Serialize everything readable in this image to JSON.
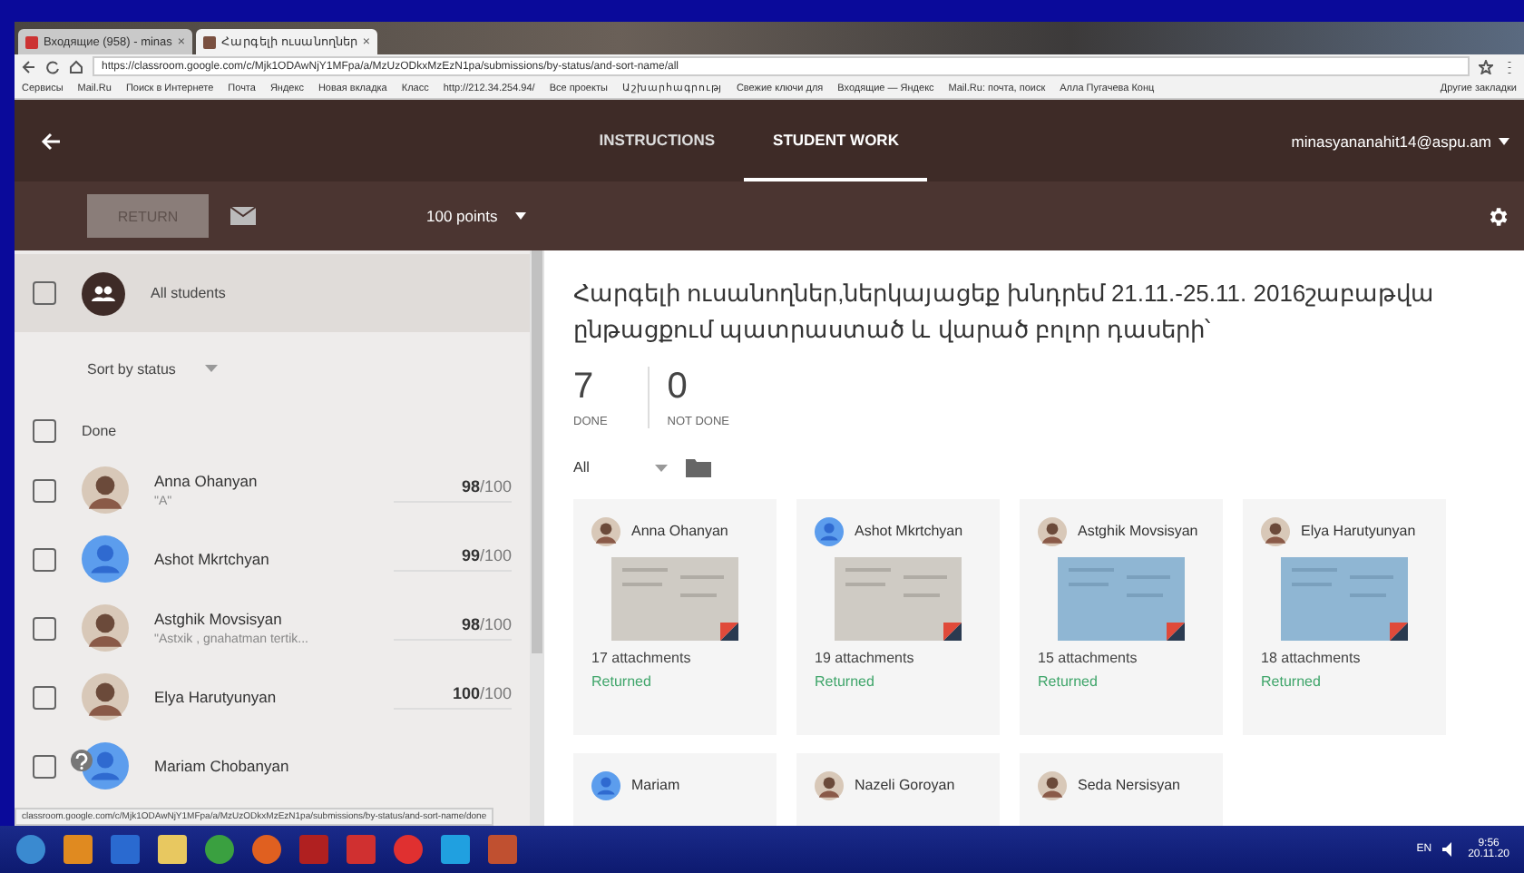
{
  "browser": {
    "tabs": [
      {
        "title": "Входящие (958) - minas",
        "close": "×",
        "selected": false
      },
      {
        "title": "Հարգելի ուսանողներ",
        "close": "×",
        "selected": true
      }
    ],
    "url": "https://classroom.google.com/c/Mjk1ODAwNjY1MFpa/a/MzUzODkxMzEzN1pa/submissions/by-status/and-sort-name/all",
    "bookmarks": [
      "Сервисы",
      "Mail.Ru",
      "Поиск в Интернете",
      "Почта",
      "Яндекс",
      "Новая вкладка",
      "Класс",
      "http://212.34.254.94/",
      "Все проекты",
      "Աշխարհագրությ",
      "Свежие ключи для",
      "Входящие — Яндекс",
      "Mail.Ru: почта, поиск",
      "Алла Пугачева Конц"
    ],
    "other_bookmarks": "Другие закладки"
  },
  "header": {
    "tabs": [
      {
        "label": "INSTRUCTIONS",
        "selected": false
      },
      {
        "label": "STUDENT WORK",
        "selected": true
      }
    ],
    "account": "minasyananahit14@aspu.am"
  },
  "toolbar": {
    "return_button": {
      "label": "RETURN",
      "disabled": true
    },
    "points": "100 points"
  },
  "sidebar": {
    "all_students": {
      "label": "All students",
      "checked": false
    },
    "sort": "Sort by status",
    "group": {
      "label": "Done",
      "checked": false
    },
    "students": [
      {
        "name": "Anna Ohanyan",
        "note": "\"A\"",
        "score": "**98**/100",
        "checked": false
      },
      {
        "name": "Ashot Mkrtchyan",
        "score": "**99**/100",
        "kind": "default",
        "checked": false
      },
      {
        "name": "Astghik Movsisyan",
        "note": "\"Astxik , gnahatman tertik...",
        "score": "**98**/100",
        "checked": false
      },
      {
        "name": "Elya Harutyunyan",
        "score": "**100**/100",
        "checked": false
      },
      {
        "name": "Mariam Chobanyan",
        "kind": "default",
        "checked": false
      }
    ]
  },
  "assignment": {
    "title": "Հարգելի ուսանողներ,ներկայացեք խնդրեմ 21.11.-25.11. 2016շաբաթվա ընթացքում պատրաստած և վարած բոլոր դասերի՝",
    "counts": [
      {
        "value": "7",
        "label": "DONE"
      },
      {
        "value": "0",
        "label": "NOT DONE"
      }
    ],
    "filter": "All",
    "cards": [
      {
        "name": "Anna Ohanyan",
        "attachments": "17 attachments",
        "status": "Returned"
      },
      {
        "name": "Ashot Mkrtchyan",
        "kind": "default",
        "attachments": "19 attachments",
        "status": "Returned"
      },
      {
        "name": "Astghik Movsisyan",
        "attachments": "15 attachments",
        "status": "Returned"
      },
      {
        "name": "Elya Harutyunyan",
        "attachments": "18 attachments",
        "status": "Returned"
      },
      {
        "name": "Mariam",
        "kind": "default"
      },
      {
        "name": "Nazeli Goroyan"
      },
      {
        "name": "Seda Nersisyan"
      }
    ]
  },
  "status_url": "classroom.google.com/c/Mjk1ODAwNjY1MFpa/a/MzUzODkxMzEzN1pa/submissions/by-status/and-sort-name/done",
  "taskbar": {
    "language": "EN",
    "time": "9:56",
    "date": "20.11.20"
  }
}
